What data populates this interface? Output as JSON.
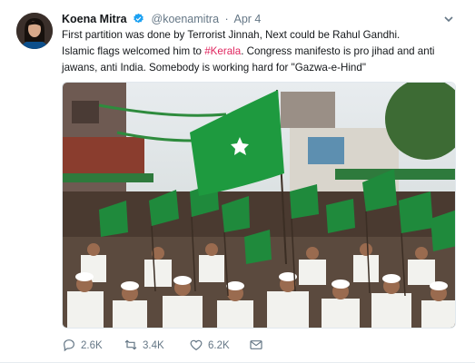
{
  "tweet": {
    "author": {
      "display_name": "Koena Mitra",
      "handle": "@koenamitra",
      "verified": true
    },
    "separator": "·",
    "timestamp": "Apr 4",
    "text": {
      "line1": "First partition was done by Terrorist Jinnah, Next could be Rahul Gandhi.",
      "line2_before": "Islamic flags welcomed him to ",
      "hashtag": "#Kerala",
      "line2_after": ". Congress manifesto is pro jihad and anti",
      "line3": "jawans, anti India. Somebody is working hard for \"Gazwa-e-Hind\""
    },
    "actions": {
      "replies": "2.6K",
      "retweets": "3.4K",
      "likes": "6.2K"
    },
    "colors": {
      "hashtag": "#e0245e",
      "verified_badge": "#1da1f2",
      "muted": "#657786"
    }
  }
}
